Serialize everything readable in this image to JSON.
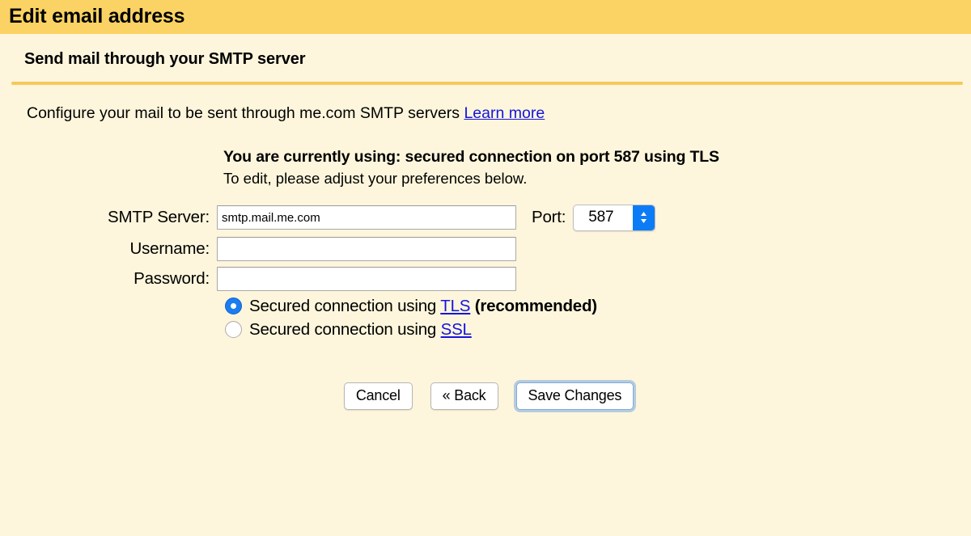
{
  "window": {
    "title": "Edit email address"
  },
  "section": {
    "heading": "Send mail through your SMTP server",
    "intro_text": "Configure your mail to be sent through me.com SMTP servers",
    "intro_link": "Learn more"
  },
  "status": {
    "current": "You are currently using: secured connection on port 587 using TLS",
    "hint": "To edit, please adjust your preferences below."
  },
  "form": {
    "smtp_server_label": "SMTP Server:",
    "smtp_server_value": "smtp.mail.me.com",
    "smtp_server_placeholder": "",
    "port_label": "Port:",
    "port_value": "587",
    "username_label": "Username:",
    "username_value": "",
    "username_placeholder": "",
    "password_label": "Password:",
    "password_value": "",
    "password_placeholder": ""
  },
  "security": {
    "tls": {
      "prefix": "Secured connection using ",
      "link": "TLS",
      "suffix": " (recommended)",
      "selected": true
    },
    "ssl": {
      "prefix": "Secured connection using ",
      "link": "SSL",
      "suffix": "",
      "selected": false
    }
  },
  "buttons": {
    "cancel": "Cancel",
    "back": "« Back",
    "save": "Save Changes"
  },
  "colors": {
    "titlebar": "#FBD364",
    "page_background": "#FDF6DC",
    "rule": "#F6C95B",
    "link": "#1414E0",
    "accent_blue": "#0C7CF6",
    "focus_ring": "#86ABD6"
  }
}
